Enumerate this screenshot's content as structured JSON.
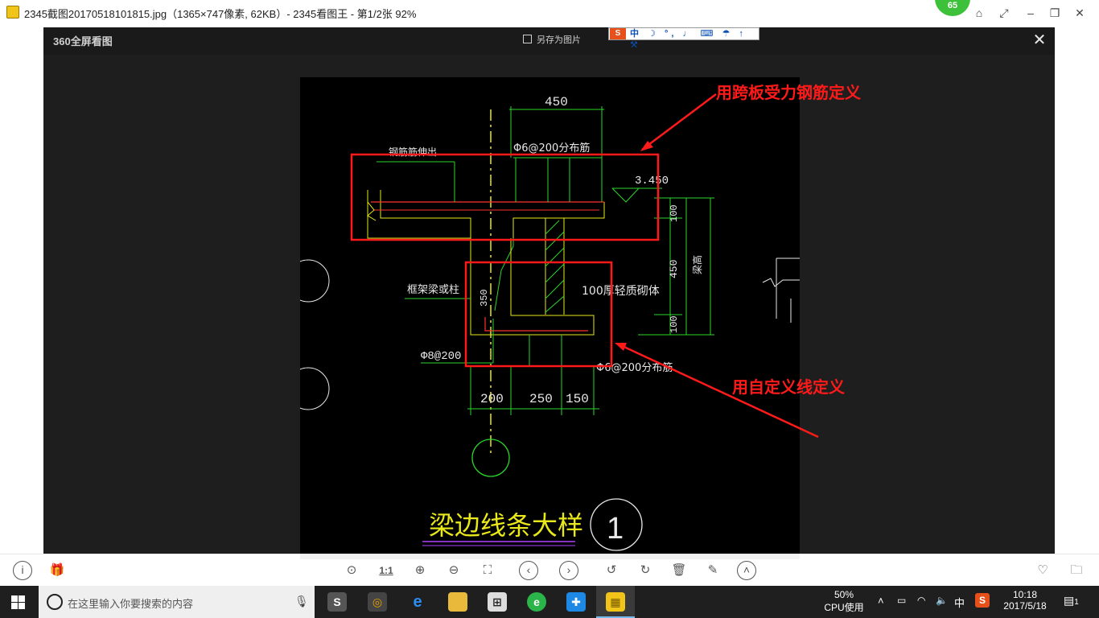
{
  "window": {
    "title": "2345截图20170518101815.jpg（1365×747像素, 62KB）- 2345看图王 - 第1/2张 92%",
    "badge_value": "65",
    "buttons": [
      "skin",
      "fullscreen",
      "minimize",
      "restore",
      "close"
    ]
  },
  "viewer": {
    "logo": "360全屏看图",
    "save_as": "另存为图片",
    "close_glyph": "✕",
    "ime_brand": "S",
    "ime_lang": "中",
    "ime_tools": "☽ °, ♩ ⌨ ☂ ↑ ⚒"
  },
  "drawing": {
    "dim_top": "450",
    "rebar_top": "Φ6@200分布筋",
    "label_top_left": "钢筋筋伸出",
    "elevation": "3.450",
    "dim_right_100a": "100",
    "dim_right_450": "450",
    "dim_right_beam": "梁高",
    "dim_right_100b": "100",
    "frame_label": "框架梁或柱",
    "dim_350": "350",
    "wall_label": "100厚轻质砌体",
    "rebar_left": "Φ8@200",
    "rebar_bottom": "Φ6@200分布筋",
    "dim_bottom": [
      "200",
      "250",
      "150"
    ],
    "title": "梁边线条大样",
    "number": "1",
    "annotation_top": "用跨板受力钢筋定义",
    "annotation_bottom": "用自定义线定义",
    "accent_red": "#ff1a1a",
    "cad_green": "#2bd62b",
    "cad_yellow": "#e8e81a"
  },
  "toolbar": {
    "left_icons": [
      "info-icon",
      "gift-icon"
    ],
    "center_icons": [
      "mouse-icon",
      "actual-size-icon",
      "zoom-in-icon",
      "zoom-out-icon",
      "fit-icon",
      "prev-icon",
      "next-icon",
      "rotate-left-icon",
      "rotate-right-icon",
      "delete-icon",
      "edit-icon",
      "more-icon"
    ],
    "actual_size_label": "1:1",
    "right_icons": [
      "favorite-icon",
      "folder-icon"
    ]
  },
  "taskbar": {
    "search_placeholder": "在这里输入你要搜索的内容",
    "cpu_percent": "50%",
    "cpu_label": "CPU使用",
    "ime": "中",
    "time": "10:18",
    "date": "2017/5/18",
    "notification_count": "1"
  }
}
